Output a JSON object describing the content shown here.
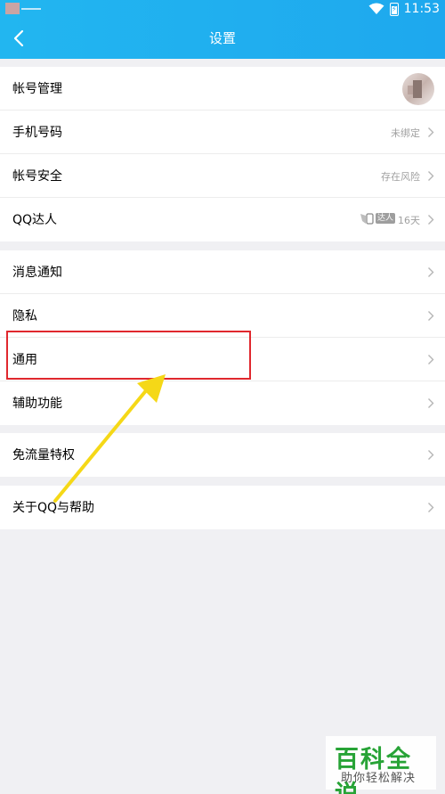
{
  "status_bar": {
    "time": "11:53"
  },
  "header": {
    "title": "设置"
  },
  "groups": [
    {
      "rows": [
        {
          "label": "帐号管理"
        },
        {
          "label": "手机号码",
          "value": "未绑定"
        },
        {
          "label": "帐号安全",
          "value": "存在风险"
        },
        {
          "label": "QQ达人",
          "badge": "达人",
          "value": "16天"
        }
      ]
    },
    {
      "rows": [
        {
          "label": "消息通知"
        },
        {
          "label": "隐私"
        },
        {
          "label": "通用"
        },
        {
          "label": "辅助功能"
        }
      ]
    },
    {
      "rows": [
        {
          "label": "免流量特权"
        }
      ]
    },
    {
      "rows": [
        {
          "label": "关于QQ与帮助"
        }
      ]
    }
  ],
  "annotation": {
    "highlight_color": "#e0282e",
    "arrow_color": "#f5d817"
  },
  "watermark": {
    "title": "百科全说",
    "subtitle": "助你轻松解决"
  },
  "colors": {
    "header_blue": "#1ea8ee",
    "background": "#f0f0f3"
  }
}
